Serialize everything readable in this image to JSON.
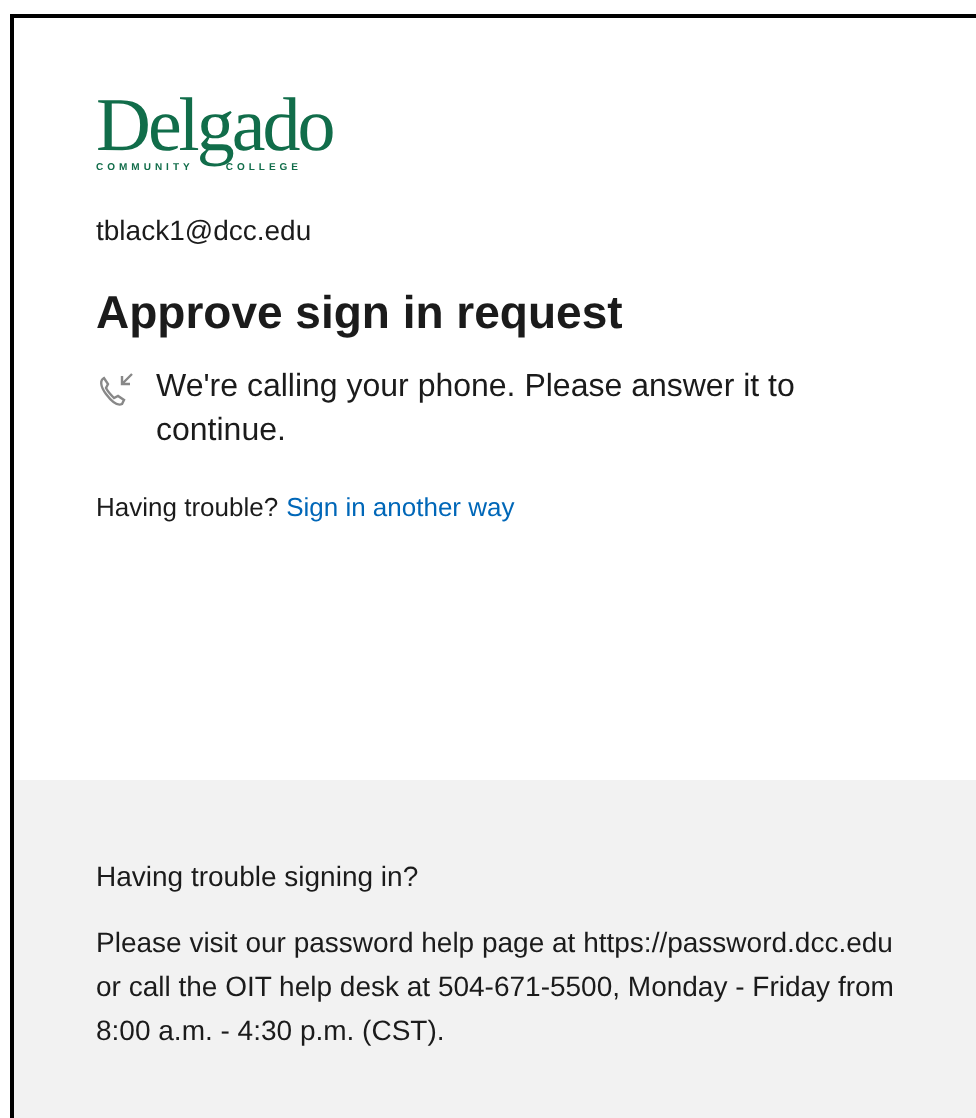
{
  "logo": {
    "name": "Delgado",
    "left_word": "COMMUNITY",
    "right_word": "COLLEGE"
  },
  "account": "tblack1@dcc.edu",
  "title": "Approve sign in request",
  "message": "We're calling your phone. Please answer it to continue.",
  "trouble": {
    "prompt": "Having trouble?",
    "link": "Sign in another way"
  },
  "footer": {
    "heading": "Having trouble signing in?",
    "text": "Please visit our password help page at https://password.dcc.edu or call the OIT help desk at 504-671-5500, Monday - Friday from 8:00 a.m. - 4:30 p.m. (CST)."
  }
}
